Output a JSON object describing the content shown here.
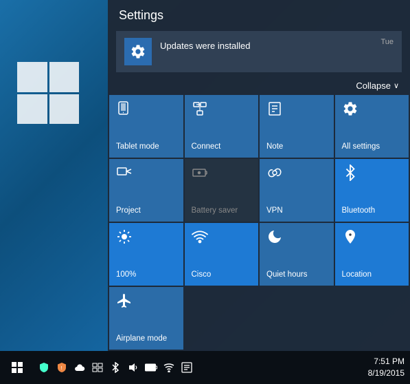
{
  "desktop": {
    "background_hint": "Windows 10 blue gradient desktop"
  },
  "action_center": {
    "title": "Settings",
    "notification": {
      "text": "Updates were installed",
      "time": "Tue"
    },
    "collapse_label": "Collapse",
    "tiles": [
      {
        "id": "tablet-mode",
        "label": "Tablet mode",
        "active": true,
        "disabled": false,
        "icon": "tablet"
      },
      {
        "id": "connect",
        "label": "Connect",
        "active": true,
        "disabled": false,
        "icon": "connect"
      },
      {
        "id": "note",
        "label": "Note",
        "active": true,
        "disabled": false,
        "icon": "note"
      },
      {
        "id": "all-settings",
        "label": "All settings",
        "active": true,
        "disabled": false,
        "icon": "gear"
      },
      {
        "id": "project",
        "label": "Project",
        "active": true,
        "disabled": false,
        "icon": "project"
      },
      {
        "id": "battery-saver",
        "label": "Battery saver",
        "active": false,
        "disabled": true,
        "icon": "battery"
      },
      {
        "id": "vpn",
        "label": "VPN",
        "active": true,
        "disabled": false,
        "icon": "vpn"
      },
      {
        "id": "bluetooth",
        "label": "Bluetooth",
        "active": true,
        "disabled": false,
        "icon": "bluetooth"
      },
      {
        "id": "brightness",
        "label": "100%",
        "active": true,
        "disabled": false,
        "icon": "brightness"
      },
      {
        "id": "cisco",
        "label": "Cisco",
        "active": true,
        "disabled": false,
        "icon": "wifi"
      },
      {
        "id": "quiet-hours",
        "label": "Quiet hours",
        "active": true,
        "disabled": false,
        "icon": "moon"
      },
      {
        "id": "location",
        "label": "Location",
        "active": true,
        "disabled": false,
        "icon": "location"
      },
      {
        "id": "airplane-mode",
        "label": "Airplane mode",
        "active": true,
        "disabled": false,
        "icon": "plane"
      },
      {
        "id": "empty1",
        "label": "",
        "active": false,
        "disabled": true,
        "icon": ""
      },
      {
        "id": "empty2",
        "label": "",
        "active": false,
        "disabled": true,
        "icon": ""
      },
      {
        "id": "empty3",
        "label": "",
        "active": false,
        "disabled": true,
        "icon": ""
      }
    ]
  },
  "taskbar": {
    "time": "7:51 PM",
    "date": "8/19/2015",
    "icons": [
      "shield",
      "alert",
      "cloud",
      "taskview",
      "bluetooth",
      "volume",
      "battery-tb",
      "wifi-tb",
      "notification"
    ]
  }
}
